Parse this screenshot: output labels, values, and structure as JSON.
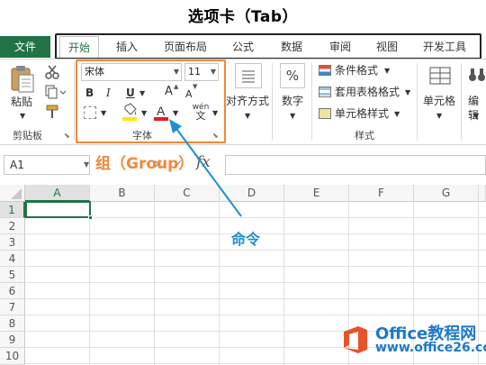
{
  "heading": "选项卡（Tab）",
  "tabs": {
    "file": "文件",
    "items": [
      "开始",
      "插入",
      "页面布局",
      "公式",
      "数据",
      "审阅",
      "视图",
      "开发工具"
    ],
    "active_index": 0
  },
  "clipboard": {
    "paste_label": "粘贴",
    "group_label": "剪贴板"
  },
  "font": {
    "font_name": "宋体",
    "font_size": "11",
    "bold": "B",
    "italic": "I",
    "underline": "U",
    "grow": "A",
    "shrink": "A",
    "wen_top": "wén",
    "wen_bottom": "文",
    "group_label": "字体"
  },
  "alignment": {
    "label": "对齐方式"
  },
  "number": {
    "icon": "%",
    "label": "数字"
  },
  "styles": {
    "items": [
      "条件格式",
      "套用表格格式",
      "单元格样式"
    ],
    "group_label": "样式"
  },
  "cells": {
    "label": "单元格"
  },
  "editing": {
    "label": "编辑"
  },
  "namebox": "A1",
  "fx": "fx",
  "annotations": {
    "group": "组（Group）",
    "command": "命令"
  },
  "sheet": {
    "columns": [
      "A",
      "B",
      "C",
      "D",
      "E",
      "F",
      "G"
    ],
    "rows": [
      "1",
      "2",
      "3",
      "4",
      "5",
      "6",
      "7",
      "8",
      "9",
      "10"
    ],
    "selected_cell": "A1"
  },
  "watermark": {
    "title": "Office教程网",
    "url": "www.office26.com"
  },
  "colors": {
    "excel_green": "#217346",
    "highlight_orange": "#f0883a",
    "arrow_blue": "#1f8fd0",
    "font_red": "#e02020",
    "fill_yellow": "#ffe800"
  }
}
